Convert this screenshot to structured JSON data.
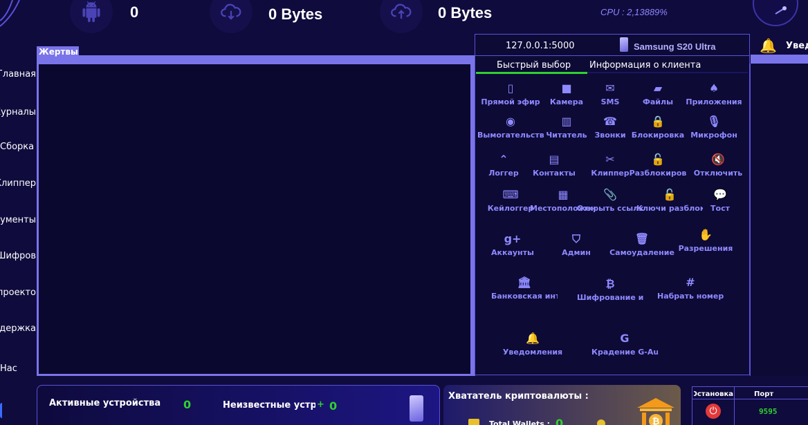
{
  "stats": {
    "devices_count": "0",
    "downloaded": "0 Bytes",
    "uploaded": "0 Bytes",
    "cpu": "CPU : 2,13889%"
  },
  "sidebar": {
    "items": [
      {
        "label": "Главная"
      },
      {
        "label": "Журналы"
      },
      {
        "label": "Сборка"
      },
      {
        "label": "Клиппер"
      },
      {
        "label": "Инструменты"
      },
      {
        "label": "Шифров"
      },
      {
        "label": "О проекто"
      },
      {
        "label": "Поддержка"
      },
      {
        "label": "Нас"
      }
    ]
  },
  "victims": {
    "title": "Жертвы"
  },
  "client": {
    "ip": "127.0.0.1:5000",
    "model": "Samsung S20 Ultra",
    "tabs": [
      "Быстрый выбор",
      "Информация  о клиента"
    ],
    "functions": [
      {
        "label": "Прямой эфир",
        "icon": "tablet-icon"
      },
      {
        "label": "Камера",
        "icon": "video-camera-icon"
      },
      {
        "label": "SMS",
        "icon": "envelope-icon"
      },
      {
        "label": "Файлы",
        "icon": "folder-open-icon"
      },
      {
        "label": "Приложения",
        "icon": "android-icon"
      },
      {
        "label": "Вымогательство",
        "icon": "ransom-icon"
      },
      {
        "label": "Читатель",
        "icon": "building-icon"
      },
      {
        "label": "Звонки",
        "icon": "phone-icon"
      },
      {
        "label": "Блокировка",
        "icon": "lock-icon"
      },
      {
        "label": "Микрофон",
        "icon": "microphone-icon"
      },
      {
        "label": "Логгер",
        "icon": "chevron-up-circle-icon"
      },
      {
        "label": "Контакты",
        "icon": "address-book-icon"
      },
      {
        "label": "Клиппер",
        "icon": "scissors-icon"
      },
      {
        "label": "Разблокиров",
        "icon": "unlock-icon"
      },
      {
        "label": "Отключить",
        "icon": "volume-mute-icon"
      },
      {
        "label": "Кейлоггер",
        "icon": "keyboard-icon"
      },
      {
        "label": "Местоположение",
        "icon": "map-icon"
      },
      {
        "label": "Открыть ссылку",
        "icon": "paperclip-icon"
      },
      {
        "label": "Ключи разблокировки",
        "icon": "unlock-alt-icon"
      },
      {
        "label": "Тост",
        "icon": "comments-icon"
      },
      {
        "label": "Аккаунты",
        "icon": "google-plus-icon"
      },
      {
        "label": "Админ",
        "icon": "shield-icon"
      },
      {
        "label": "Самоудаление",
        "icon": "trash-icon"
      },
      {
        "label": "Разрешения",
        "icon": "hand-icon"
      },
      {
        "label": "Банковская инъекция",
        "icon": "bank-icon"
      },
      {
        "label": "Шифрование инъекция",
        "icon": "bitcoin-icon"
      },
      {
        "label": "Набрать номер",
        "icon": "hashtag-icon"
      },
      {
        "label": "Уведомления",
        "icon": "bell-icon"
      },
      {
        "label": "Крадение G-Auth",
        "icon": "google-icon"
      }
    ]
  },
  "notifications": {
    "title": "Уведомления"
  },
  "bottom": {
    "active_devices_label": "Активные устройства",
    "active_devices_value": "0",
    "unknown_devices_label": "Неизвестные устройства",
    "unknown_devices_plus": "+",
    "unknown_devices_value": "0",
    "crypto_title": "Хвататель криптовалюты :",
    "total_wallets_label": "Total Wallets :",
    "total_wallets_value": "0"
  },
  "port_table": {
    "headers": [
      "Запуск/Остановка",
      "Порт"
    ],
    "port": "9595"
  },
  "colors": {
    "background": "#0f0b3d",
    "accent": "#7a74ea",
    "icon": "#8f8aff",
    "success": "#2fd12f",
    "danger": "#e23a3a"
  }
}
